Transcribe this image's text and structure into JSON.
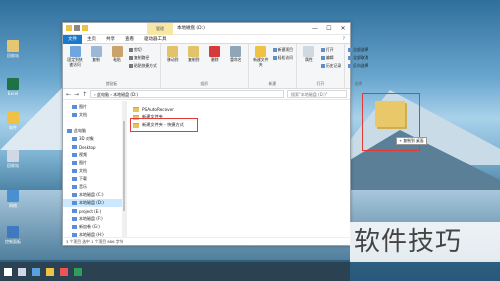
{
  "window": {
    "title": "本地磁盘 (D:)",
    "context_tab": "管理",
    "controls": {
      "minimize": "—",
      "maximize": "☐",
      "close": "✕"
    }
  },
  "tabs": [
    "文件",
    "主页",
    "共享",
    "查看",
    "驱动器工具"
  ],
  "ribbon": {
    "clipboard": {
      "name": "剪贴板",
      "pin": "固定到快速访问",
      "copy": "复制",
      "paste": "粘贴",
      "cut": "剪切",
      "copy_path": "复制路径",
      "paste_shortcut": "粘贴快捷方式"
    },
    "organize": {
      "name": "组织",
      "move_to": "移动到",
      "copy_to": "复制到",
      "delete": "删除",
      "rename": "重命名"
    },
    "new": {
      "name": "新建",
      "new_folder": "新建文件夹",
      "new_item": "新建项目",
      "easy_access": "轻松访问"
    },
    "open": {
      "name": "打开",
      "properties": "属性",
      "open": "打开",
      "edit": "编辑",
      "history": "历史记录"
    },
    "select": {
      "name": "选择",
      "select_all": "全部选择",
      "select_none": "全部取消",
      "invert": "反向选择"
    }
  },
  "address": {
    "path": "› 此电脑 › 本地磁盘 (D:)",
    "search_placeholder": "搜索\"本地磁盘 (D:)\""
  },
  "nav": [
    {
      "label": "图片",
      "sel": false,
      "ind": true
    },
    {
      "label": "文档",
      "sel": false,
      "ind": true
    },
    {
      "label": "",
      "sel": false,
      "ind": false
    },
    {
      "label": "此电脑",
      "sel": false,
      "ind": false
    },
    {
      "label": "3D 对象",
      "sel": false,
      "ind": true
    },
    {
      "label": "Desktop",
      "sel": false,
      "ind": true
    },
    {
      "label": "视频",
      "sel": false,
      "ind": true
    },
    {
      "label": "图片",
      "sel": false,
      "ind": true
    },
    {
      "label": "文档",
      "sel": false,
      "ind": true
    },
    {
      "label": "下载",
      "sel": false,
      "ind": true
    },
    {
      "label": "音乐",
      "sel": false,
      "ind": true
    },
    {
      "label": "本地磁盘 (C:)",
      "sel": false,
      "ind": true
    },
    {
      "label": "本地磁盘 (D:)",
      "sel": true,
      "ind": true
    },
    {
      "label": "project (E:)",
      "sel": false,
      "ind": true
    },
    {
      "label": "本地磁盘 (F:)",
      "sel": false,
      "ind": true
    },
    {
      "label": "新加卷 (G:)",
      "sel": false,
      "ind": true
    },
    {
      "label": "本地磁盘 (H:)",
      "sel": false,
      "ind": true
    }
  ],
  "files": [
    {
      "name": "PSAutoRecover",
      "hl": false
    },
    {
      "name": "新建文件夹",
      "hl": false
    },
    {
      "name": "新建文件夹 - 快捷方式",
      "hl": true
    }
  ],
  "status": "3 个项目   选中 1 个项目  686 字节",
  "desktop_icons": [
    "回收站",
    "Excel",
    "软件",
    "回收站",
    "网络",
    "控制面板"
  ],
  "drag_tip": "+ 复制到 桌面",
  "watermark": "软件技巧"
}
